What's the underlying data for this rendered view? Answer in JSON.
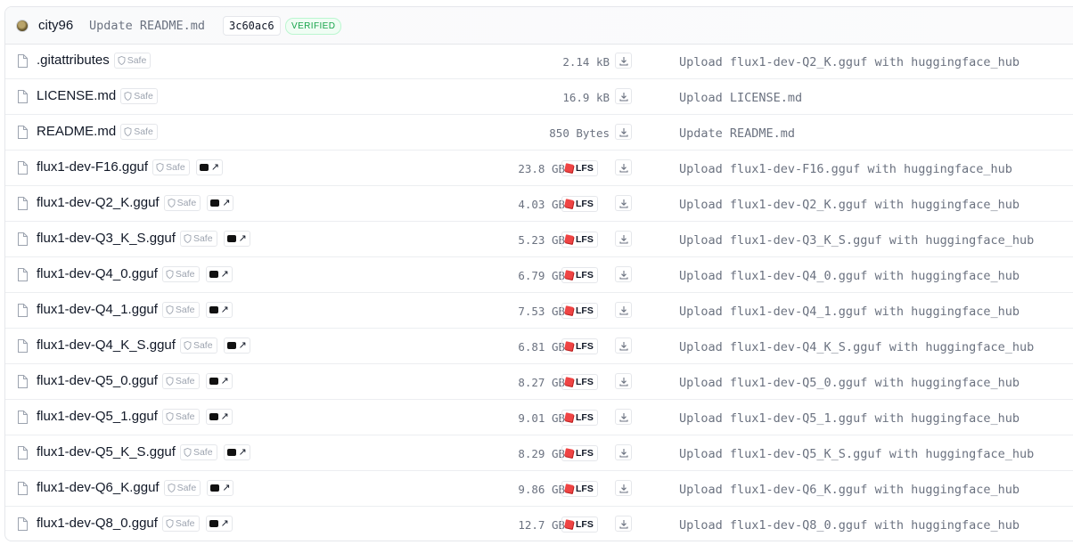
{
  "header": {
    "author": "city96",
    "commit_message": "Update README.md",
    "commit_hash": "3c60ac6",
    "verified_label": "VERIFIED",
    "avatar_icon": "user-avatar"
  },
  "labels": {
    "safe": "Safe",
    "lfs": "LFS"
  },
  "icons": {
    "file": "file-icon",
    "shield": "shield-icon",
    "download": "download-icon",
    "xet": "xet-link-icon",
    "lfs": "lfs-cube-icon"
  },
  "colors": {
    "verified": "#16a34a",
    "lfs_cube": "#ef4444",
    "muted": "#6b7280"
  },
  "files": [
    {
      "name": ".gitattributes",
      "size": "2.14 kB",
      "lfs": false,
      "xet": false,
      "commit_message": "Upload flux1-dev-Q2_K.gguf with huggingface_hub"
    },
    {
      "name": "LICENSE.md",
      "size": "16.9 kB",
      "lfs": false,
      "xet": false,
      "commit_message": "Upload LICENSE.md"
    },
    {
      "name": "README.md",
      "size": "850 Bytes",
      "lfs": false,
      "xet": false,
      "commit_message": "Update README.md"
    },
    {
      "name": "flux1-dev-F16.gguf",
      "size": "23.8 GB",
      "lfs": true,
      "xet": true,
      "commit_message": "Upload flux1-dev-F16.gguf with huggingface_hub"
    },
    {
      "name": "flux1-dev-Q2_K.gguf",
      "size": "4.03 GB",
      "lfs": true,
      "xet": true,
      "commit_message": "Upload flux1-dev-Q2_K.gguf with huggingface_hub"
    },
    {
      "name": "flux1-dev-Q3_K_S.gguf",
      "size": "5.23 GB",
      "lfs": true,
      "xet": true,
      "commit_message": "Upload flux1-dev-Q3_K_S.gguf with huggingface_hub"
    },
    {
      "name": "flux1-dev-Q4_0.gguf",
      "size": "6.79 GB",
      "lfs": true,
      "xet": true,
      "commit_message": "Upload flux1-dev-Q4_0.gguf with huggingface_hub"
    },
    {
      "name": "flux1-dev-Q4_1.gguf",
      "size": "7.53 GB",
      "lfs": true,
      "xet": true,
      "commit_message": "Upload flux1-dev-Q4_1.gguf with huggingface_hub"
    },
    {
      "name": "flux1-dev-Q4_K_S.gguf",
      "size": "6.81 GB",
      "lfs": true,
      "xet": true,
      "commit_message": "Upload flux1-dev-Q4_K_S.gguf with huggingface_hub"
    },
    {
      "name": "flux1-dev-Q5_0.gguf",
      "size": "8.27 GB",
      "lfs": true,
      "xet": true,
      "commit_message": "Upload flux1-dev-Q5_0.gguf with huggingface_hub"
    },
    {
      "name": "flux1-dev-Q5_1.gguf",
      "size": "9.01 GB",
      "lfs": true,
      "xet": true,
      "commit_message": "Upload flux1-dev-Q5_1.gguf with huggingface_hub"
    },
    {
      "name": "flux1-dev-Q5_K_S.gguf",
      "size": "8.29 GB",
      "lfs": true,
      "xet": true,
      "commit_message": "Upload flux1-dev-Q5_K_S.gguf with huggingface_hub"
    },
    {
      "name": "flux1-dev-Q6_K.gguf",
      "size": "9.86 GB",
      "lfs": true,
      "xet": true,
      "commit_message": "Upload flux1-dev-Q6_K.gguf with huggingface_hub"
    },
    {
      "name": "flux1-dev-Q8_0.gguf",
      "size": "12.7 GB",
      "lfs": true,
      "xet": true,
      "commit_message": "Upload flux1-dev-Q8_0.gguf with huggingface_hub"
    }
  ]
}
